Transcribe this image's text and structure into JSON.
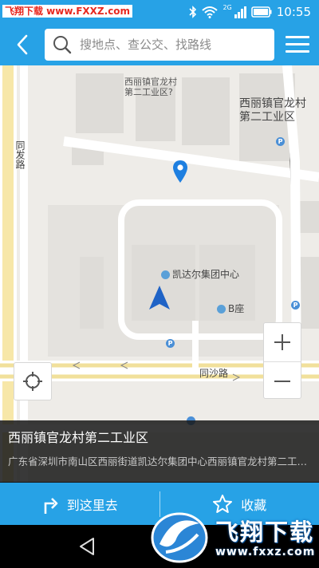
{
  "status_bar": {
    "watermark_text": "飞翔下载 www.FXXZ.com",
    "network_label": "2G",
    "time": "10:55",
    "icons": [
      "bluetooth-icon",
      "wifi-icon",
      "signal-icon",
      "battery-icon"
    ]
  },
  "top_bar": {
    "back_icon": "back-arrow-icon",
    "search_placeholder": "搜地点、查公交、找路线",
    "menu_icon": "menu-icon"
  },
  "map": {
    "labels": {
      "area_small": "西丽镇官龙村\n第二工业区?",
      "area_big": "西丽镇官龙村\n第二工业区",
      "building_center": "凯达尔集团中心",
      "building_b": "B座",
      "road_tongfa": "同发路",
      "road_tongsha": "同沙路"
    },
    "selected_pin": "location-pin-icon",
    "current_position": "navigation-arrow-icon",
    "zoom_in_icon": "plus-icon",
    "zoom_out_icon": "minus-icon",
    "locate_icon": "crosshair-icon"
  },
  "info_panel": {
    "title": "西丽镇官龙村第二工业区",
    "address": "广东省深圳市南山区西丽街道凯达尔集团中心西丽镇官龙村第二工业区"
  },
  "action_bar": {
    "go_here_label": "到这里去",
    "favorite_label": "收藏"
  },
  "watermark": {
    "text": "飞翔下载",
    "url": "www.fxxz.com"
  },
  "colors": {
    "accent": "#27a2e6",
    "map_bg": "#eeece8",
    "pin": "#1e7fe0"
  }
}
